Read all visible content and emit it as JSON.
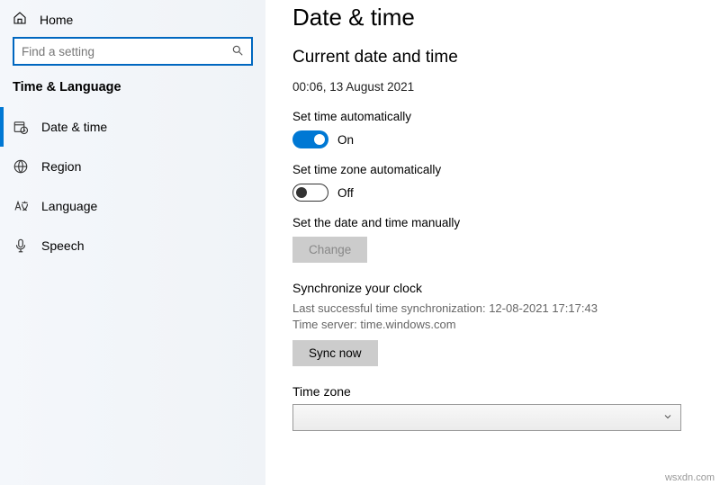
{
  "sidebar": {
    "home": "Home",
    "search_placeholder": "Find a setting",
    "section": "Time & Language",
    "items": [
      {
        "label": "Date & time"
      },
      {
        "label": "Region"
      },
      {
        "label": "Language"
      },
      {
        "label": "Speech"
      }
    ]
  },
  "main": {
    "title": "Date & time",
    "current_heading": "Current date and time",
    "current_value": "00:06, 13 August 2021",
    "set_time_auto_label": "Set time automatically",
    "set_time_auto_state": "On",
    "set_tz_auto_label": "Set time zone automatically",
    "set_tz_auto_state": "Off",
    "manual_label": "Set the date and time manually",
    "change_button": "Change",
    "sync_heading": "Synchronize your clock",
    "sync_last": "Last successful time synchronization: 12-08-2021 17:17:43",
    "sync_server": "Time server: time.windows.com",
    "sync_button": "Sync now",
    "tz_label": "Time zone",
    "tz_value": ""
  },
  "watermark": "wsxdn.com"
}
